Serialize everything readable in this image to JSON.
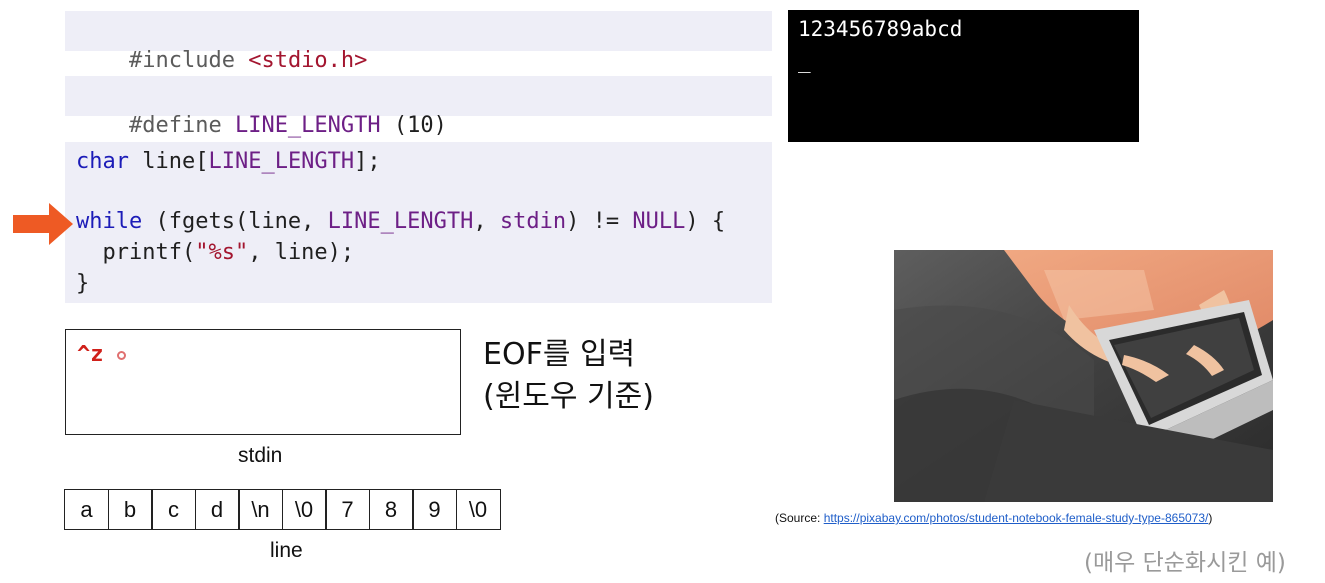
{
  "code": {
    "include_keyword": "#include",
    "include_header": "<stdio.h>",
    "define_keyword": "#define",
    "define_name": "LINE_LENGTH",
    "define_value": "(10)",
    "decl_type": "char",
    "decl_rest_a": " line[",
    "decl_macro": "LINE_LENGTH",
    "decl_rest_b": "];",
    "while_kw": "while",
    "while_a": " (fgets(line, ",
    "while_macro": "LINE_LENGTH",
    "while_b": ", ",
    "while_stdin": "stdin",
    "while_c": ") != ",
    "while_null": "NULL",
    "while_d": ") {",
    "printf_a": "  printf(",
    "printf_str": "\"%s\"",
    "printf_b": ", line);",
    "close_brace": "}"
  },
  "terminal": {
    "output": "123456789abcd",
    "cursor": "_"
  },
  "stdin_box": {
    "content": "^z",
    "label": "stdin"
  },
  "eof_note": {
    "line1": "EOF를 입력",
    "line2": "(윈도우 기준)"
  },
  "line_array": {
    "cells": [
      "a",
      "b",
      "c",
      "d",
      "\\n",
      "\\0",
      "7",
      "8",
      "9",
      "\\0"
    ],
    "label": "line"
  },
  "photo": {
    "source_prefix": "(Source: ",
    "source_url": "https://pixabay.com/photos/student-notebook-female-study-type-865073/",
    "source_suffix": ")"
  },
  "footnote": "(매우 단순화시킨 예)",
  "colors": {
    "arrow": "#ee5a24",
    "code_bg": "#eeeef7",
    "stdin_text": "#d0201a"
  }
}
